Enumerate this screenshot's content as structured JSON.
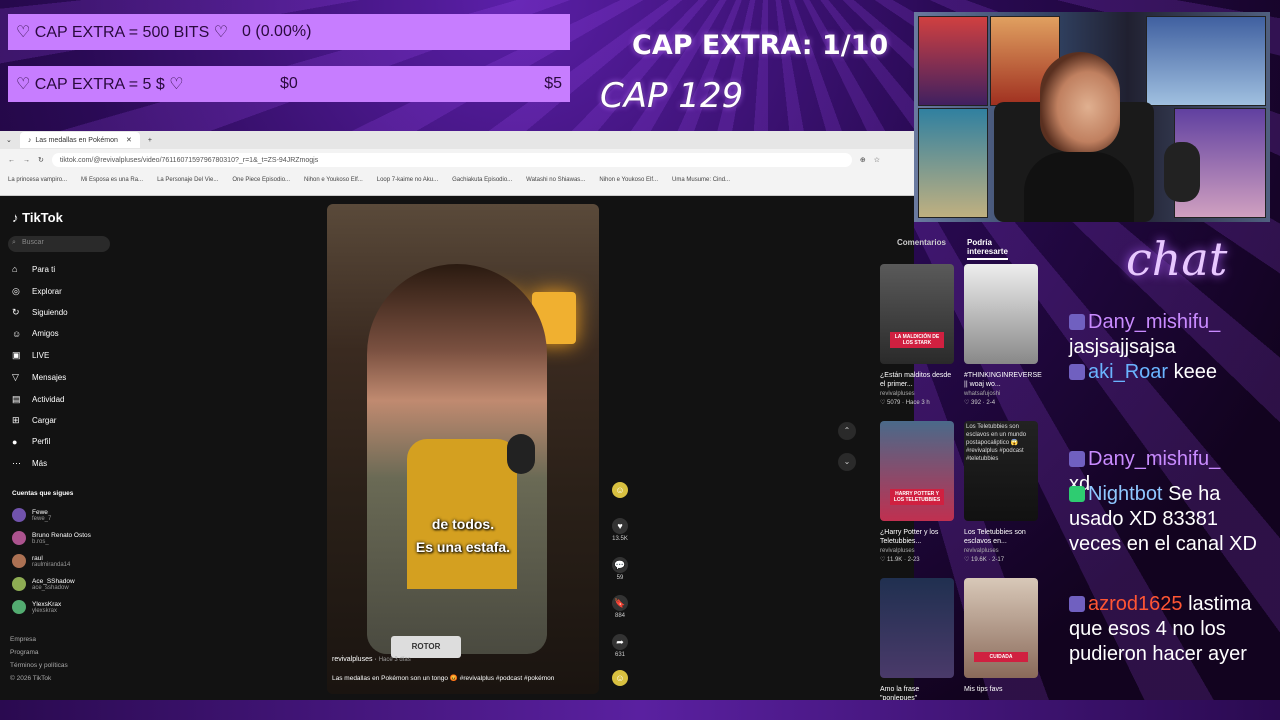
{
  "overlay": {
    "bits_label": "♡ CAP EXTRA = 500 BITS ♡",
    "bits_value": "0 (0.00%)",
    "dollar_label": "♡ CAP EXTRA = 5 $ ♡",
    "dollar_current": "$0",
    "dollar_goal": "$5",
    "dollar_progress": 0,
    "bits_progress": 0,
    "cap_extra": "CAP EXTRA: 1/10",
    "cap_number": "CAP 129"
  },
  "browser": {
    "tab_title": "Las medallas en Pokémon",
    "url": "tiktok.com/@revivalpluses/video/7611607159796780310?_r=1&_t=ZS-94JRZmogjs",
    "bookmarks": [
      "La princesa vampiro...",
      "Mi Esposa es una Ra...",
      "La Personaje Del Vie...",
      "One Piece Episodio...",
      "Nihon e Youkoso Elf...",
      "Loop 7-kaime no Aku...",
      "Gachiakuta Episodio...",
      "Watashi no Shiawas...",
      "Nihon e Youkoso Elf...",
      "Uma Musume: Cind..."
    ]
  },
  "tiktok": {
    "logo": "TikTok",
    "search_placeholder": "Buscar",
    "nav": [
      {
        "icon": "⌂",
        "label": "Para ti"
      },
      {
        "icon": "◎",
        "label": "Explorar"
      },
      {
        "icon": "↻",
        "label": "Siguiendo"
      },
      {
        "icon": "☺",
        "label": "Amigos"
      },
      {
        "icon": "▣",
        "label": "LIVE"
      },
      {
        "icon": "▽",
        "label": "Mensajes"
      },
      {
        "icon": "▤",
        "label": "Actividad"
      },
      {
        "icon": "⊞",
        "label": "Cargar"
      },
      {
        "icon": "●",
        "label": "Perfil"
      },
      {
        "icon": "⋯",
        "label": "Más"
      }
    ],
    "following_title": "Cuentas que sigues",
    "following": [
      {
        "name": "Fewe",
        "handle": "fewe_7"
      },
      {
        "name": "Bruno Renato Ostos",
        "handle": "b.ros_"
      },
      {
        "name": "raul",
        "handle": "raulmiranda14"
      },
      {
        "name": "Ace_SShadow",
        "handle": "ace_sshadow"
      },
      {
        "name": "YlexsKrax",
        "handle": "ylexskrax"
      }
    ],
    "footer": [
      "Empresa",
      "Programa",
      "Términos y políticas",
      "© 2026 TikTok"
    ],
    "video": {
      "subtitle1": "de todos.",
      "subtitle2": "Es una estafa.",
      "author": "revivalpluses",
      "date": "Hace 3 días",
      "caption": "Las medallas en Pokémon son un tongo 😡 #revivalplus #podcast #pokémon",
      "watermark": "ROTOR"
    },
    "actions": [
      {
        "icon": "♥",
        "count": "13.5K"
      },
      {
        "icon": "💬",
        "count": "59"
      },
      {
        "icon": "🔖",
        "count": "884"
      },
      {
        "icon": "➦",
        "count": "631"
      }
    ],
    "right_tabs": [
      "Comentarios",
      "Podría interesarte"
    ],
    "cards": [
      {
        "title": "¿Están malditos desde el primer...",
        "user": "revivalpluses",
        "stat": "♡ 5079 · Hace 3 h",
        "thumb_text": "LA MALDICIÓN DE LOS STARK"
      },
      {
        "title": "#THINKINGINREVERSE || woaj wo...",
        "user": "whatsafujoshi",
        "stat": "♡ 392 · 2-4",
        "thumb_text": ""
      },
      {
        "title": "¿Harry Potter y los Teletubbies...",
        "user": "revivalpluses",
        "stat": "♡ 11.9K · 2-23",
        "thumb_text": "HARRY POTTER Y LOS TELETUBBIES"
      },
      {
        "title": "Los Teletubbies son esclavos en...",
        "user": "revivalpluses",
        "stat": "♡ 19.6K · 2-17",
        "thumb_text": "Los Teletubbies son esclavos en un mundo postapocaliptico 😱 #revivalplus #podcast #teletubbies"
      },
      {
        "title": "Amo la frase \"ponlepues\"",
        "user": "",
        "stat": "",
        "thumb_text": ""
      },
      {
        "title": "Mis tips favs",
        "user": "",
        "stat": "",
        "thumb_text": "CUIDADA"
      }
    ]
  },
  "chat": {
    "title": "chat",
    "messages": [
      {
        "user": "Dany_mishifu_",
        "text": "jasjsajjsajsa",
        "color": "#c98bff"
      },
      {
        "user": "aki_Roar",
        "text": "keee",
        "color": "#6ab4ff"
      },
      {
        "user": "Dany_mishifu_",
        "text": "xd",
        "color": "#c98bff"
      },
      {
        "user": "Nightbot",
        "text": "Se ha usado XD 83381 veces en el canal XD",
        "color": "#8fc8ff"
      },
      {
        "user": "azrod1625",
        "text": "lastima que esos 4 no los pudieron hacer ayer",
        "color": "#ff5533"
      }
    ]
  }
}
